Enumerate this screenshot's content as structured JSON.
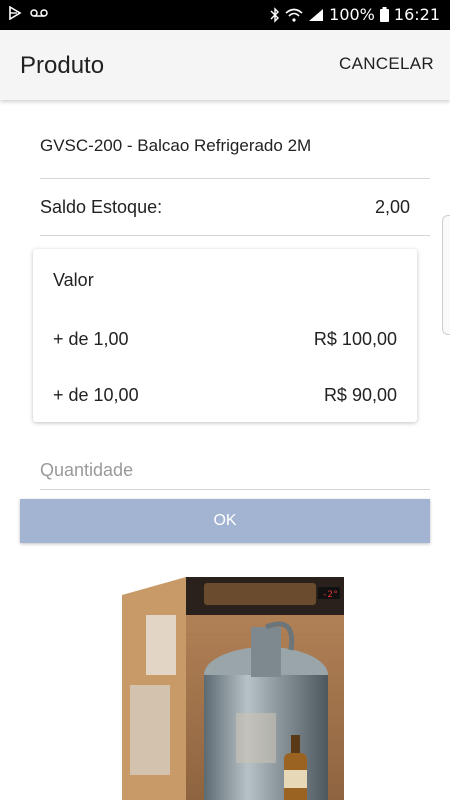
{
  "status_bar": {
    "battery_text": "100%",
    "time": "16:21"
  },
  "header": {
    "title": "Produto",
    "cancel_label": "CANCELAR"
  },
  "product": {
    "name": "GVSC-200 - Balcao Refrigerado 2M",
    "stock_label": "Saldo Estoque:",
    "stock_value": "2,00"
  },
  "price_card": {
    "title": "Valor",
    "rows": [
      {
        "qty": "+ de 1,00",
        "value": "R$ 100,00"
      },
      {
        "qty": "+ de 10,00",
        "value": "R$ 90,00"
      }
    ]
  },
  "quantity_input": {
    "placeholder": "Quantidade",
    "value": ""
  },
  "ok_button": {
    "label": "OK",
    "color": "#a2b4d1"
  }
}
